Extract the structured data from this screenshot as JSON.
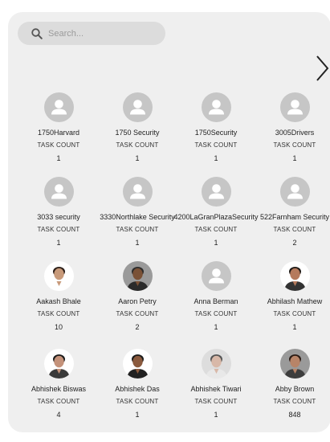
{
  "search": {
    "placeholder": "Search..."
  },
  "colors": {
    "panel": "#efefef",
    "search_bg": "#dcdcdc",
    "avatar_placeholder": "#c6c6c6"
  },
  "icons": {
    "search": "search-icon",
    "next": "chevron-right-icon",
    "avatar": "user-silhouette-icon"
  },
  "employees": [
    {
      "name": "1750Harvard",
      "label": "TASK COUNT",
      "count": "1",
      "avatar": "placeholder"
    },
    {
      "name": "1750 Security",
      "label": "TASK COUNT",
      "count": "1",
      "avatar": "placeholder"
    },
    {
      "name": "1750Security",
      "label": "TASK COUNT",
      "count": "1",
      "avatar": "placeholder"
    },
    {
      "name": "3005Drivers",
      "label": "TASK COUNT",
      "count": "1",
      "avatar": "placeholder"
    },
    {
      "name": "3033 security",
      "label": "TASK COUNT",
      "count": "1",
      "avatar": "placeholder"
    },
    {
      "name": "3330Northlake Security",
      "label": "TASK COUNT",
      "count": "1",
      "avatar": "placeholder"
    },
    {
      "name": "4200LaGranPlazaSecurity",
      "label": "TASK COUNT",
      "count": "1",
      "avatar": "placeholder"
    },
    {
      "name": "522Farnham Security",
      "label": "TASK COUNT",
      "count": "2",
      "avatar": "placeholder"
    },
    {
      "name": "Aakash Bhale",
      "label": "TASK COUNT",
      "count": "10",
      "avatar": "photo"
    },
    {
      "name": "Aaron Petry",
      "label": "TASK COUNT",
      "count": "2",
      "avatar": "photo"
    },
    {
      "name": "Anna Berman",
      "label": "TASK COUNT",
      "count": "1",
      "avatar": "placeholder"
    },
    {
      "name": "Abhilash Mathew",
      "label": "TASK COUNT",
      "count": "1",
      "avatar": "photo"
    },
    {
      "name": "Abhishek Biswas",
      "label": "TASK COUNT",
      "count": "4",
      "avatar": "photo"
    },
    {
      "name": "Abhishek Das",
      "label": "TASK COUNT",
      "count": "1",
      "avatar": "photo"
    },
    {
      "name": "Abhishek Tiwari",
      "label": "TASK COUNT",
      "count": "1",
      "avatar": "photo"
    },
    {
      "name": "Abby Brown",
      "label": "TASK COUNT",
      "count": "848",
      "avatar": "photo"
    }
  ]
}
